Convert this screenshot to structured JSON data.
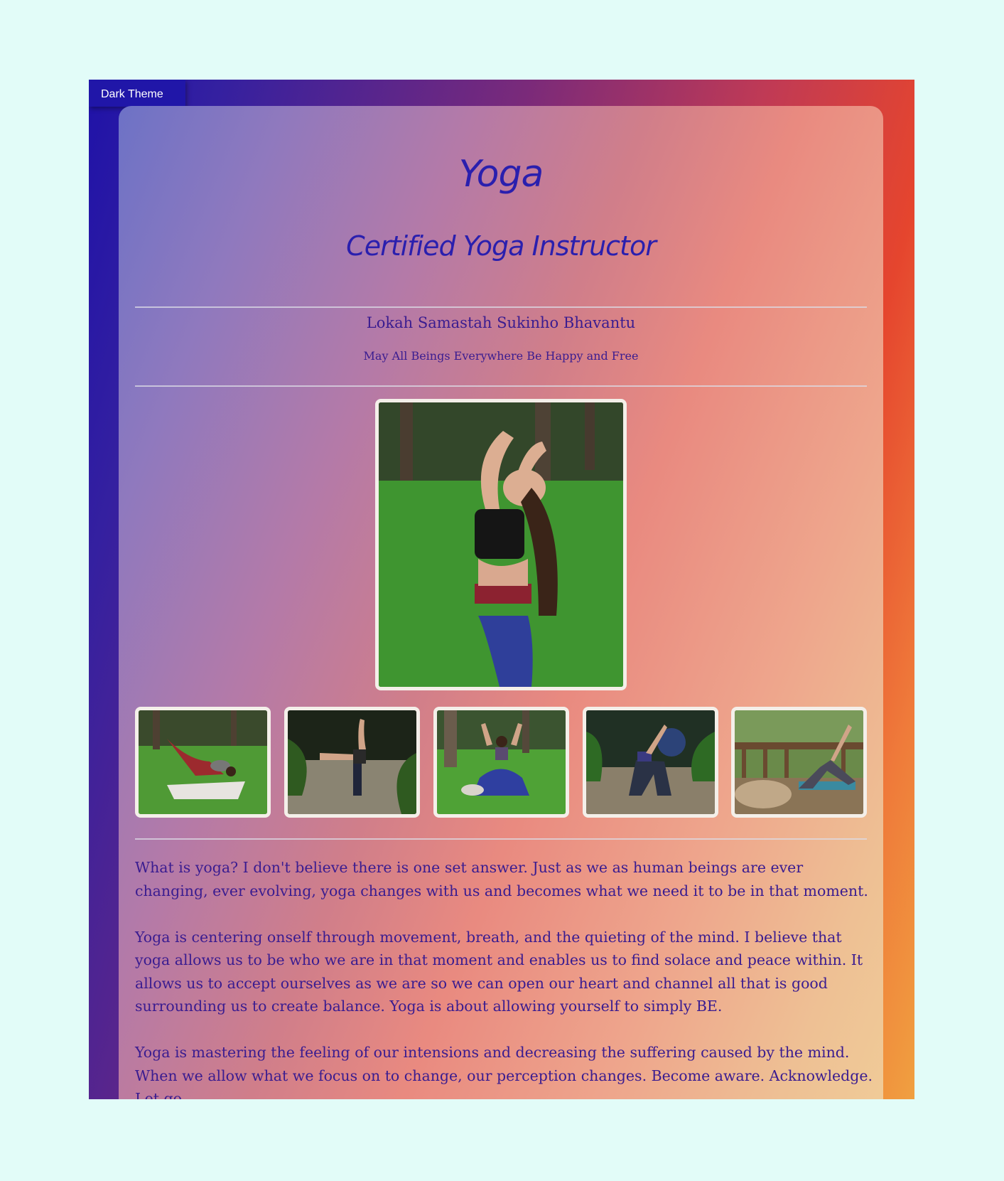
{
  "theme_toggle": {
    "label": "Dark Theme"
  },
  "header": {
    "title": "Yoga",
    "subtitle": "Certified Yoga Instructor"
  },
  "quote": {
    "mantra": "Lokah Samastah Sukinho Bhavantu",
    "translation": "May All Beings Everywhere Be Happy and Free"
  },
  "content": {
    "paragraphs": [
      "What is yoga? I don't believe there is one set answer. Just as we as human beings are ever changing, ever evolving, yoga changes with us and becomes what we need it to be in that moment.",
      "Yoga is centering onself through movement, breath, and the quieting of the mind. I believe that yoga allows us to be who we are in that moment and enables us to find solace and peace within. It allows us to accept ourselves as we are so we can open our heart and channel all that is good surrounding us to create balance. Yoga is about allowing yourself to simply BE.",
      "Yoga is mastering the feeling of our intensions and decreasing the suffering caused by the mind. When we allow what we focus on to change, our perception changes. Become aware. Acknowledge. Let go."
    ]
  },
  "colors": {
    "page_background": "#e2fcf8",
    "heading": "#2a1fae",
    "body_text": "#3a1c90",
    "toggle_background": "#2016a8"
  }
}
